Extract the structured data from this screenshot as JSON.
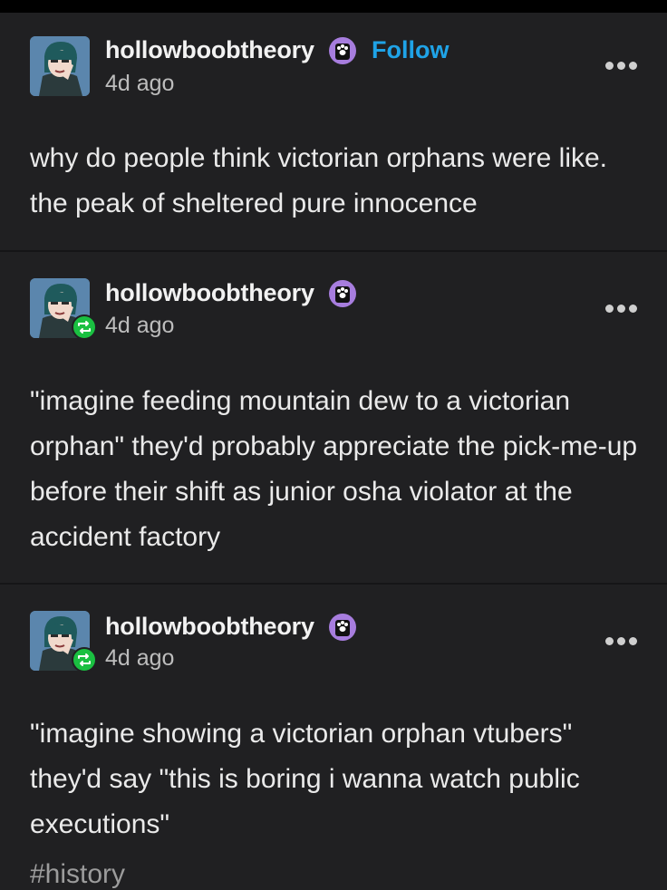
{
  "posts": [
    {
      "username": "hollowboobtheory",
      "follow_label": "Follow",
      "time": "4d ago",
      "text": "why do people think victorian orphans were like. the peak of sheltered pure innocence"
    },
    {
      "username": "hollowboobtheory",
      "time": "4d ago",
      "text": "\"imagine feeding mountain dew to a victorian orphan\" they'd probably appreciate the pick-me-up before their shift as junior osha violator at the accident factory"
    },
    {
      "username": "hollowboobtheory",
      "time": "4d ago",
      "text": "\"imagine showing a victorian orphan vtubers\" they'd say \"this is boring i wanna watch public executions\""
    }
  ],
  "tags": [
    "#history"
  ],
  "colors": {
    "background": "#202022",
    "follow": "#1fa3e7",
    "reblog_badge": "#1ac041",
    "paw_badge": "#a77dde"
  },
  "icons": [
    "avatar",
    "paw-badge-icon",
    "reblog-icon",
    "more-options-icon"
  ]
}
